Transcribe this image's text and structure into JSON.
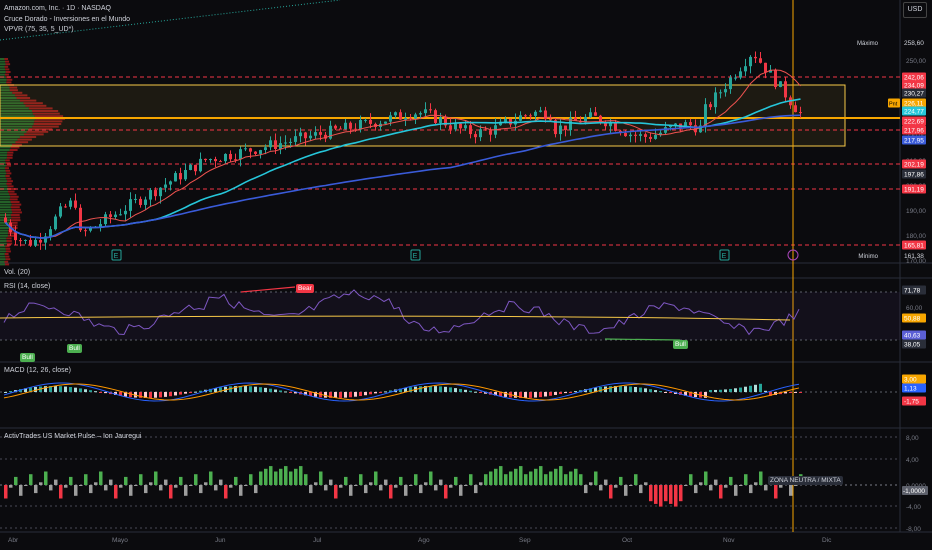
{
  "header": {
    "title": "Amazon.com, Inc. · 1D · NASDAQ",
    "indicator1": "Cruce Dorado - Inversiones en el Mundo",
    "indicator2": "VPVR (75, 35, 5_UD*)",
    "currency": "USD"
  },
  "panes": {
    "volume_label": "Vol. (20)",
    "rsi_label": "RSI (14, close)",
    "macd_label": "MACD (12, 26, close)",
    "pulse_label": "ActivTrades US Market Pulse – Ion Jauregui"
  },
  "price_axis": {
    "ticks": [
      "250,00",
      "240,00",
      "230,00",
      "220,00",
      "210,00",
      "200,00",
      "190,00",
      "180,00",
      "170,00"
    ],
    "max_label": "Máximo",
    "max_value": "258,60",
    "min_label": "Mínimo",
    "min_value": "161,38",
    "tags": [
      {
        "text": "242,06",
        "color": "#f23645"
      },
      {
        "text": "234,09",
        "color": "#f23645"
      },
      {
        "text": "230,27",
        "color": "#2a2e39"
      },
      {
        "text": "226,11",
        "color": "#f7a600",
        "prefix": "Pnt"
      },
      {
        "text": "224,77",
        "color": "#26c6da"
      },
      {
        "text": "222,69",
        "color": "#f23645"
      },
      {
        "text": "217,96",
        "color": "#f23645"
      },
      {
        "text": "217,95",
        "color": "#3a5bd9"
      },
      {
        "text": "202,19",
        "color": "#f23645"
      },
      {
        "text": "197,86",
        "color": "#2a2e39"
      },
      {
        "text": "191,19",
        "color": "#f23645"
      },
      {
        "text": "165,81",
        "color": "#f23645"
      }
    ]
  },
  "rsi_axis": {
    "ticks": [
      "60,00"
    ],
    "tags": [
      {
        "text": "71,78",
        "color": "#2a2e39"
      },
      {
        "text": "50,88",
        "color": "#f7a600"
      },
      {
        "text": "40,63",
        "color": "#5b5fd6"
      },
      {
        "text": "38,05",
        "color": "#2a2e39"
      }
    ]
  },
  "macd_axis": {
    "tags": [
      {
        "text": "3,00",
        "color": "#f7a600"
      },
      {
        "text": "1,13",
        "color": "#2962ff"
      },
      {
        "text": "-1,75",
        "color": "#f23645"
      }
    ]
  },
  "pulse_axis": {
    "ticks": [
      "8,00",
      "4,00",
      "0,0000",
      "-4,00",
      "-8,00"
    ],
    "tags": [
      {
        "text": "-1,0000",
        "color": "#5d606b"
      }
    ],
    "zone_label": "ZONA NEUTRA / MIXTA"
  },
  "rsi_labels": {
    "bear": "Bear",
    "bull1": "Bull",
    "bull2": "Bull",
    "bull3": "Bull"
  },
  "x_axis": {
    "ticks": [
      "Abr",
      "Mayo",
      "Jun",
      "Jul",
      "Ago",
      "Sep",
      "Oct",
      "Nov",
      "Dic"
    ]
  },
  "earnings_icon": "E",
  "colors": {
    "up": "#26a69a",
    "down": "#f23645",
    "sma_fast": "#ef5350",
    "sma_mid": "#26c6da",
    "sma_slow": "#3a5bd9",
    "zone": "#f7c948",
    "rsi": "#7e57c2"
  }
}
